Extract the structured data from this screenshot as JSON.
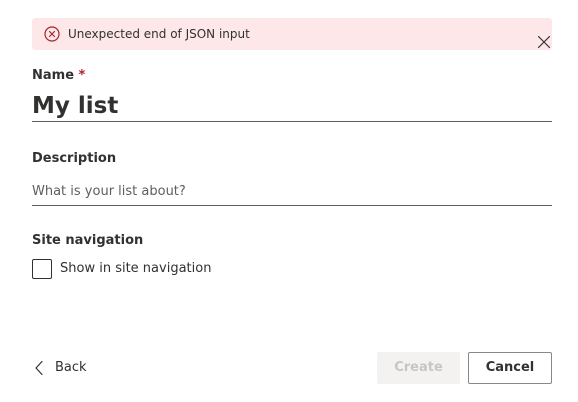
{
  "error": {
    "message": "Unexpected end of JSON input",
    "icon": "error-circle-icon",
    "close_icon": "close-icon",
    "color": "#a4262c",
    "background": "#fde7e9"
  },
  "form": {
    "name": {
      "label": "Name",
      "required_marker": "*",
      "value": "My list"
    },
    "description": {
      "label": "Description",
      "value": "",
      "placeholder": "What is your list about?"
    },
    "site_navigation": {
      "label": "Site navigation",
      "checkbox_label": "Show in site navigation",
      "checked": false
    }
  },
  "footer": {
    "back_label": "Back",
    "back_icon": "chevron-left-icon",
    "create_label": "Create",
    "create_disabled": true,
    "cancel_label": "Cancel"
  }
}
